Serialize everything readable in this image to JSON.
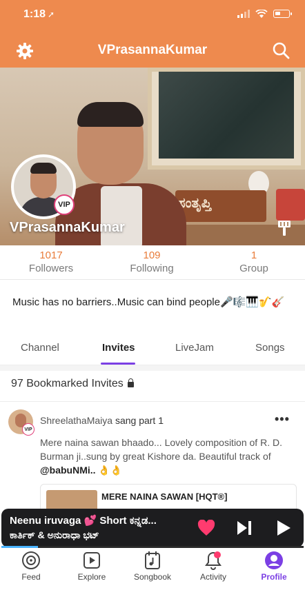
{
  "status_bar": {
    "time": "1:18"
  },
  "header": {
    "title": "VPrasannaKumar"
  },
  "profile": {
    "username": "VPrasannaKumar",
    "badge": "VIP",
    "cover_sign_text": "ಸಂತೃಪ್ತಿ"
  },
  "stats": [
    {
      "value": "1017",
      "label": "Followers"
    },
    {
      "value": "109",
      "label": "Following"
    },
    {
      "value": "1",
      "label": "Group"
    }
  ],
  "bio": "Music has no barriers..Music can bind people🎤🎼🎹🎷🎸",
  "tabs": [
    {
      "label": "Channel",
      "active": false
    },
    {
      "label": "Invites",
      "active": true
    },
    {
      "label": "LiveJam",
      "active": false
    },
    {
      "label": "Songs",
      "active": false
    }
  ],
  "bookmarked": {
    "label": "97 Bookmarked Invites"
  },
  "post": {
    "author": "ShreelathaMaiya",
    "action": " sang part 1",
    "author_badge": "VIP",
    "more_label": "•••",
    "text_prefix": "Mere naina sawan bhaado... Lovely composition of R. D. Burman ji..sung by great Kishore da. Beautiful track of ",
    "handle": "@babuNMi..",
    "text_suffix": " 👌👌",
    "song_title": "MERE NAINA SAWAN [HQT®]"
  },
  "player": {
    "title": "Neenu iruvaga 💕 Short ಕನ್ನಡ...",
    "artist": "ಕಾರ್ತಿಕ್ & ಅನುರಾಧಾ ಭಟ್",
    "progress": 0.12
  },
  "nav": [
    {
      "label": "Feed",
      "icon": "feed-icon",
      "active": false
    },
    {
      "label": "Explore",
      "icon": "explore-icon",
      "active": false
    },
    {
      "label": "Songbook",
      "icon": "songbook-icon",
      "active": false
    },
    {
      "label": "Activity",
      "icon": "activity-icon",
      "active": false
    },
    {
      "label": "Profile",
      "icon": "profile-icon",
      "active": true
    }
  ],
  "colors": {
    "header": "#ee8a4e",
    "accent_purple": "#7b3fe4",
    "stat_number": "#e97c3a",
    "vip_ring": "#e0407a",
    "heart": "#ff3b6f"
  }
}
